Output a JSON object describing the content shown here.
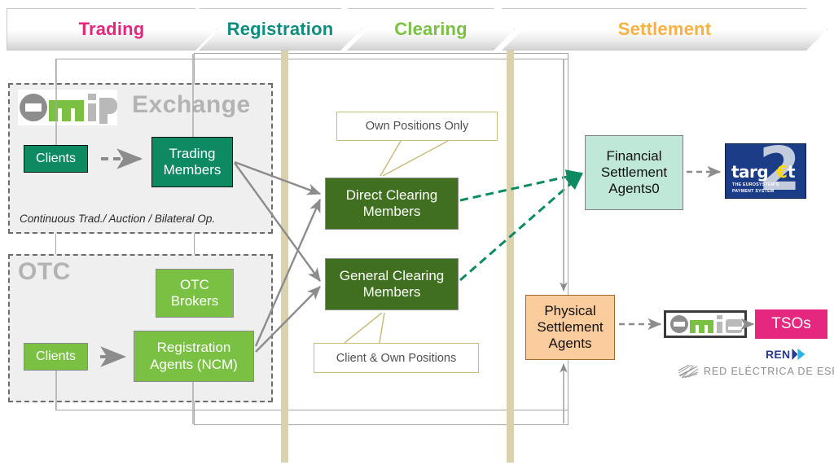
{
  "banner": {
    "stages": [
      {
        "label": "Trading",
        "color": "#e5257e"
      },
      {
        "label": "Registration",
        "color": "#0c8d7e"
      },
      {
        "label": "Clearing",
        "color": "#7ac143"
      },
      {
        "label": "Settlement",
        "color": "#fcb040"
      }
    ]
  },
  "exchange": {
    "title": "Exchange",
    "logo_text": "omip",
    "footnote": "Continuous Trad./ Auction / Bilateral Op.",
    "clients": "Clients",
    "trading_members_line1": "Trading",
    "trading_members_line2": "Members"
  },
  "otc": {
    "title": "OTC",
    "clients": "Clients",
    "brokers_line1": "OTC",
    "brokers_line2": "Brokers",
    "agents_line1": "Registration",
    "agents_line2": "Agents (NCM)"
  },
  "clearing": {
    "direct_line1": "Direct Clearing",
    "direct_line2": "Members",
    "general_line1": "General Clearing",
    "general_line2": "Members",
    "callout_top": "Own Positions Only",
    "callout_bottom": "Client & Own Positions"
  },
  "settlement": {
    "financial_line1": "Financial",
    "financial_line2": "Settlement",
    "financial_line3": "Agents0",
    "physical_line1": "Physical",
    "physical_line2": "Settlement",
    "physical_line3": "Agents",
    "target2": {
      "word": "targ",
      "euro": "€",
      "tail": "t",
      "two": "2",
      "subtitle_line1": "THE EUROSYSTEM'S",
      "subtitle_line2": "PAYMENT SYSTEM"
    },
    "omie_text": "omie",
    "tsos": "TSOs",
    "ren": "REN",
    "ree": "RED ELÉCTRICA DE ESPAÑA"
  },
  "colors": {
    "teal_node": "#0e8a63",
    "green_node": "#7ac143",
    "dark_green_node": "#40701f",
    "mint_node": "#bfe8d8",
    "peach_node": "#fbcc9c",
    "tan_bar": "#d9d2ac",
    "gray_arrow": "#8c8c8c",
    "teal_arrow": "#0e8a63",
    "callout_border": "#c9bd7e",
    "tsos_bg": "#e6277f",
    "target2_bg": "#1b3c86"
  }
}
